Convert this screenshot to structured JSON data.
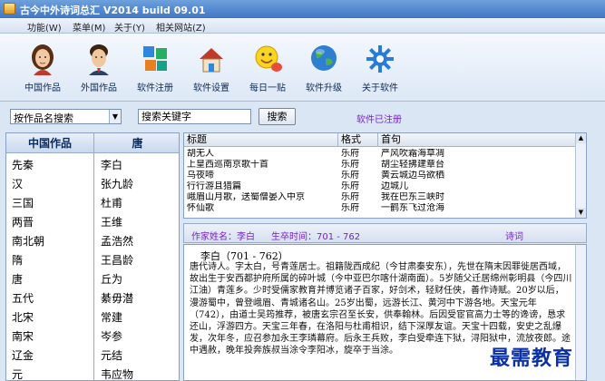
{
  "window": {
    "title": "古今中外诗词总汇 V2014 build 09.01"
  },
  "menu": [
    "功能(W)",
    "菜单(M)",
    "关于(Y)",
    "相关网站(Z)"
  ],
  "toolbar": [
    {
      "label": "中国作品",
      "icon": "chinese-woman-icon"
    },
    {
      "label": "外国作品",
      "icon": "foreign-man-icon"
    },
    {
      "label": "软件注册",
      "icon": "cubes-icon"
    },
    {
      "label": "软件设置",
      "icon": "house-settings-icon"
    },
    {
      "label": "每日一贴",
      "icon": "smiley-chat-icon"
    },
    {
      "label": "软件升级",
      "icon": "globe-icon"
    },
    {
      "label": "关于软件",
      "icon": "gear-icon"
    }
  ],
  "search": {
    "mode": "按作品名搜索",
    "keyword_placeholder": "搜索关键字",
    "button": "搜索",
    "registered": "软件已注册"
  },
  "dynasties": {
    "header": "中国作品",
    "items": [
      "先秦",
      "汉",
      "三国",
      "两晋",
      "南北朝",
      "隋",
      "唐",
      "五代",
      "北宋",
      "南宋",
      "辽金",
      "元"
    ]
  },
  "poets": {
    "header": "唐",
    "items": [
      "李白",
      "张九龄",
      "杜甫",
      "王维",
      "孟浩然",
      "王昌龄",
      "丘为",
      "綦毋潜",
      "常建",
      "岑参",
      "元结",
      "韦应物"
    ]
  },
  "poem_table": {
    "columns": [
      "标题",
      "格式",
      "首句"
    ],
    "rows": [
      [
        "胡无人",
        "乐府",
        "严风吹霜海草凋"
      ],
      [
        "上皇西巡南京歌十首",
        "乐府",
        "胡尘轻拂建章台"
      ],
      [
        "乌夜啼",
        "乐府",
        "黄云城边乌欲栖"
      ],
      [
        "行行游且猎篇",
        "乐府",
        "边城儿"
      ],
      [
        "峨眉山月歌，送蜀僧晏入中京",
        "乐府",
        "我在巴东三峡时"
      ],
      [
        "怀仙歌",
        "乐府",
        "一鹤东飞过沧海"
      ]
    ]
  },
  "info": {
    "author": "作家姓名：李白",
    "life": "生卒时间：701 - 762",
    "poem_label": "诗词"
  },
  "bio": {
    "title": "李白（701 - 762）",
    "text": "唐代诗人。字太白，号青莲居士。祖籍陇西成纪（今甘肃秦安东），先世在隋末因罪徙居西域，故出生于安西都护府所属的碎叶城（今中亚巴尔喀什湖南面）。5岁随父迁居绵州彰明县（今四川江油）青莲乡。少时受儒家教育并博览诸子百家，好剑术，轻财任侠，善作诗赋。20岁以后，漫游蜀中，曾登峨眉、青城诸名山。25岁出蜀，远游长江、黄河中下游各地。天宝元年（742），由道士吴筠推荐，被唐玄宗召至长安，供奉翰林。后因受宦官高力士等的谗谤，恳求还山，浮游四方。天宝三年春，在洛阳与杜甫相识，结下深厚友谊。天宝十四载，安史之乱爆发，次年冬，应召参加永王李璘幕府。后永王兵败，李白受牵连下狱，浔阳狱中，流放夜郎。途中遇赦，晚年投奔族叔当涂令李阳冰，旋卒于当涂。"
  },
  "watermark": "最需教育"
}
